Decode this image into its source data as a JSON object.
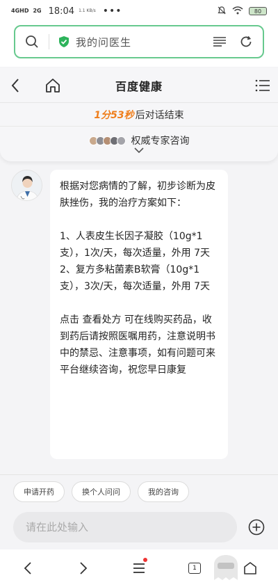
{
  "status_bar": {
    "network_4g": "4GHD",
    "network_2g": "2G",
    "time": "18:04",
    "speed": "1.1 KB/s",
    "more": "•••",
    "battery": "80"
  },
  "browser": {
    "url_text": "我的问医生"
  },
  "header": {
    "title": "百度健康"
  },
  "timer": {
    "value": "1分53秒",
    "suffix": "后对话结束"
  },
  "expert": {
    "label": "权威专家咨询"
  },
  "chat": {
    "message": "根据对您病情的了解，初步诊断为皮肤挫伤，我的治疗方案如下：\n\n1、人表皮生长因子凝胶（10g*1支），1次/天，每次适量，外用 7天\n2、复方多粘菌素B软膏（10g*1支），3次/天，每次适量，外用 7天\n\n点击 查看处方 可在线购买药品，收到药后请按照医嘱用药，注意说明书中的禁忌、注意事项，如有问题可来平台继续咨询，祝您早日康复"
  },
  "quick_actions": [
    "申请开药",
    "换个人问问",
    "我的咨询"
  ],
  "input": {
    "placeholder": "请在此处输入"
  },
  "bottom_nav": {
    "tab_count": "1"
  },
  "colors": {
    "url_border": "#67c98e",
    "shield": "#2db35b",
    "timer": "#ef7d1a",
    "notification_dot": "#e33333"
  }
}
